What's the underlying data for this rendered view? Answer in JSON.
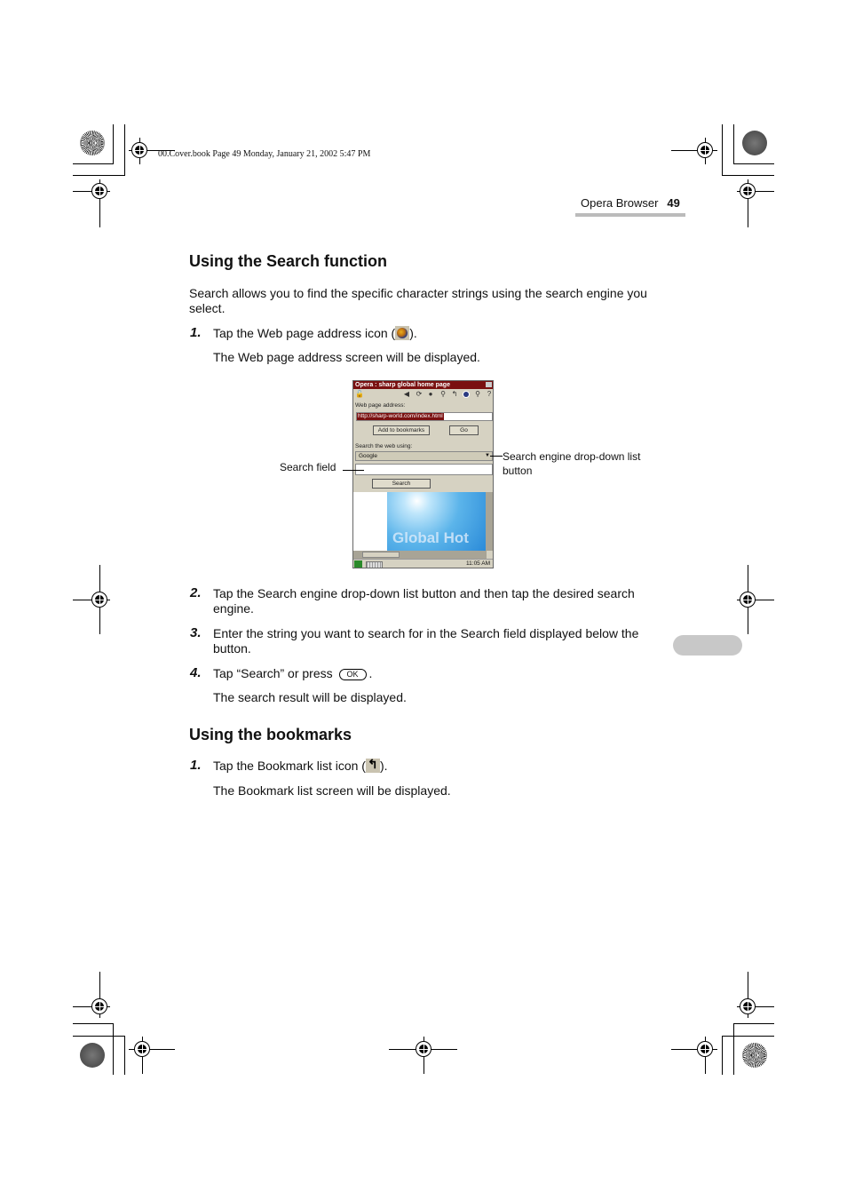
{
  "print_header": {
    "file_info": "00.Cover.book  Page 49  Monday, January 21, 2002  5:47 PM"
  },
  "page_header": {
    "section": "Opera Browser",
    "page_number": "49"
  },
  "section_search": {
    "title": "Using the Search function",
    "intro": "Search allows you to find the specific character strings using the search engine you select.",
    "steps": [
      {
        "number": "1.",
        "text_before": "Tap the Web page address icon (",
        "icon": "globe-icon",
        "text_after": ").",
        "result": "The Web page address screen will be displayed."
      },
      {
        "number": "2.",
        "text": "Tap the Search engine drop-down list button and then tap the desired search engine."
      },
      {
        "number": "3.",
        "text": "Enter the string you want to search for in the Search field displayed below the button."
      },
      {
        "number": "4.",
        "text_before": "Tap “Search” or press",
        "key": "OK",
        "text_after": ".",
        "result": "The search result will be displayed."
      }
    ]
  },
  "device_screen": {
    "title": "Opera : sharp global home page",
    "toolbar_icons": [
      "lock-icon",
      "back-icon",
      "reload-icon",
      "stop-icon",
      "settings-icon",
      "bookmark-icon",
      "globe-icon",
      "search-icon",
      "help-icon"
    ],
    "address_label": "Web page address:",
    "address_value": "http://sharp-world.com/index.html",
    "add_bookmark_button": "Add to bookmarks",
    "go_button": "Go",
    "search_label": "Search the web using:",
    "search_engine_selected": "Google",
    "search_field_value": "",
    "search_button": "Search",
    "content_banner_text": "Global Hot",
    "clock": "11:05 AM"
  },
  "callouts": {
    "search_field": "Search field",
    "dropdown": "Search engine drop-down list button"
  },
  "section_bookmarks": {
    "title": "Using the bookmarks",
    "steps": [
      {
        "number": "1.",
        "text_before": "Tap the Bookmark list icon (",
        "icon": "bookmark-list-icon",
        "text_after": ").",
        "result": "The Bookmark list screen will be displayed."
      }
    ]
  }
}
